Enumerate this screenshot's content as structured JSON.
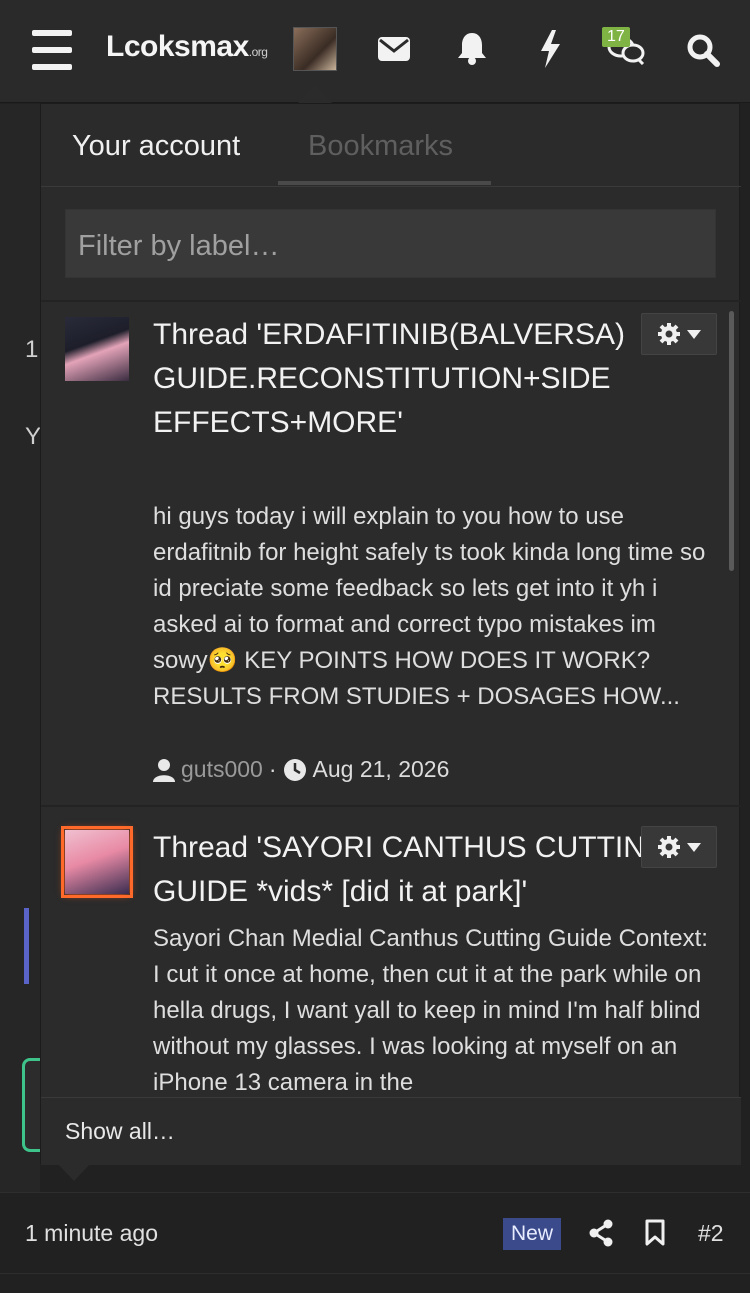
{
  "header": {
    "logo_text": "Lcoksmax",
    "logo_domain": ".org",
    "conversations_badge": "17",
    "icons": [
      "menu-icon",
      "avatar",
      "envelope-icon",
      "bell-icon",
      "bolt-icon",
      "chat-icon",
      "search-icon"
    ]
  },
  "background_fragments": {
    "number": "1",
    "letter": "Y"
  },
  "popup": {
    "tabs": [
      {
        "label": "Your account",
        "active": false
      },
      {
        "label": "Bookmarks",
        "active": true
      }
    ],
    "filter_placeholder": "Filter by label…",
    "items": [
      {
        "title": "Thread 'ERDAFITINIB(BALVERSA) GUIDE.RECONSTITUTION+SIDE EFFECTS+MORE'",
        "snippet": "hi guys today i will explain to you how to use erdafitnib for height safely ts took kinda long time so id preciate some feedback so lets get into it yh i asked ai to format and correct typo mistakes im sowy🥺 KEY POINTS HOW DOES IT WORK? RESULTS FROM STUDIES + DOSAGES HOW...",
        "user": "guts000",
        "separator": "·",
        "date": "Aug 21, 2026"
      },
      {
        "title": "Thread 'SAYORI CANTHUS CUTTING GUIDE *vids* [did it at park]'",
        "snippet": "Sayori Chan Medial Canthus Cutting Guide Context: I cut it once at home, then cut it at the park while on hella drugs, I want yall to keep in mind I'm half blind without my glasses. I was looking at myself on an iPhone 13 camera in the"
      }
    ],
    "show_all": "Show all…"
  },
  "post_footer": {
    "time": "1 minute ago",
    "new_label": "New",
    "post_number": "#2"
  },
  "colors": {
    "badge_green": "#7fb343",
    "new_badge": "#3b4a8a",
    "avatar_glow": "#ff6a2a"
  }
}
